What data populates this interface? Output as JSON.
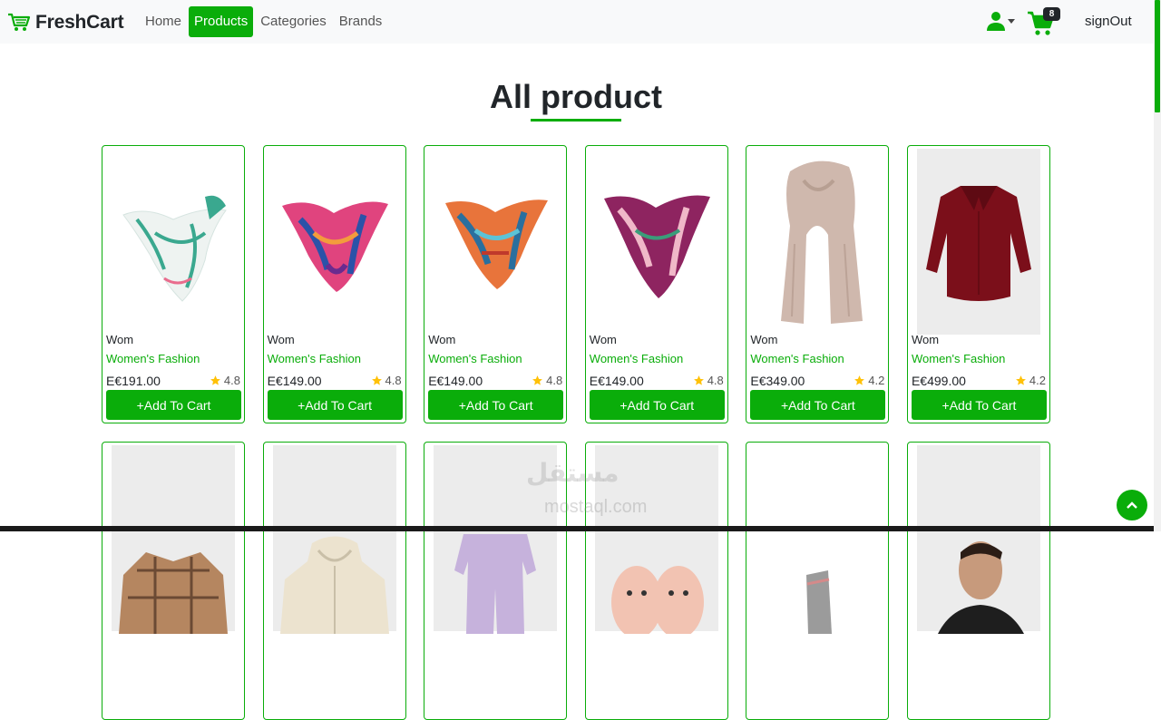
{
  "brand": {
    "name": "FreshCart"
  },
  "nav": {
    "links": [
      {
        "label": "Home"
      },
      {
        "label": "Products"
      },
      {
        "label": "Categories"
      },
      {
        "label": "Brands"
      }
    ]
  },
  "cart": {
    "count": "8"
  },
  "auth": {
    "signout_label": "signOut"
  },
  "page": {
    "title": "All product"
  },
  "products": [
    {
      "name": "Wom",
      "category": "Women's Fashion",
      "price": "E€191.00",
      "rating": "4.8",
      "add_label": "+Add To Cart"
    },
    {
      "name": "Wom",
      "category": "Women's Fashion",
      "price": "E€149.00",
      "rating": "4.8",
      "add_label": "+Add To Cart"
    },
    {
      "name": "Wom",
      "category": "Women's Fashion",
      "price": "E€149.00",
      "rating": "4.8",
      "add_label": "+Add To Cart"
    },
    {
      "name": "Wom",
      "category": "Women's Fashion",
      "price": "E€149.00",
      "rating": "4.8",
      "add_label": "+Add To Cart"
    },
    {
      "name": "Wom",
      "category": "Women's Fashion",
      "price": "E€349.00",
      "rating": "4.2",
      "add_label": "+Add To Cart"
    },
    {
      "name": "Wom",
      "category": "Women's Fashion",
      "price": "E€499.00",
      "rating": "4.2",
      "add_label": "+Add To Cart"
    }
  ],
  "watermark": {
    "arabic": "مستقل",
    "latin": "mostaql.com"
  },
  "colors": {
    "accent": "#0aad0a",
    "star": "#ffc107"
  }
}
